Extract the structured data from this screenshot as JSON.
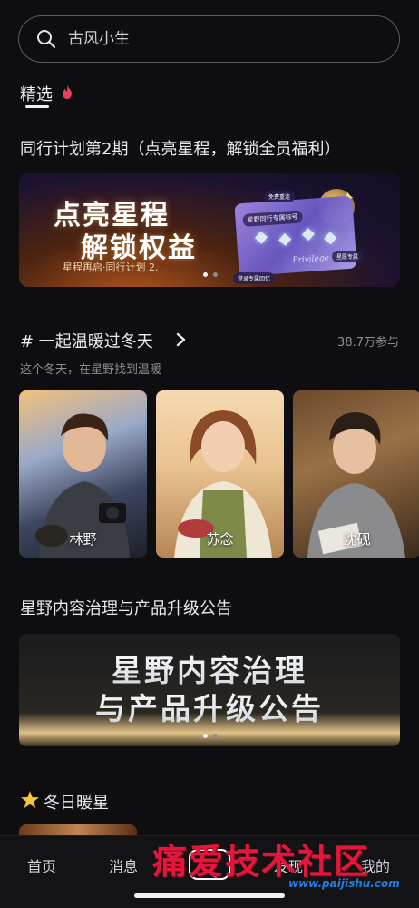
{
  "search": {
    "placeholder": "古风小生",
    "icon": "search-icon"
  },
  "tabs": [
    {
      "label": "精选",
      "active": true,
      "icon": "fire-icon"
    }
  ],
  "feature": {
    "title": "同行计划第2期（点亮星程，解锁全员福利）",
    "banner": {
      "line1": "点亮星程",
      "line2": "解锁权益",
      "sub": "星程再启·同行计划 2.",
      "card_tags": [
        "免费重连",
        "星野同行专属标号",
        "星愿专属",
        "星野书签",
        "登录专属回忆",
        "星野体内公益"
      ],
      "card_script": "Privilege Gift",
      "page": 1,
      "pages": 2
    }
  },
  "topic": {
    "title": "# 一起温暖过冬天",
    "count": "38.7万参与",
    "desc": "这个冬天，在星野找到温暖",
    "cards": [
      {
        "name": "林野"
      },
      {
        "name": "苏念"
      },
      {
        "name": "沈砚"
      }
    ]
  },
  "notice": {
    "title": "星野内容治理与产品升级公告",
    "banner_l1": "星野内容治理",
    "banner_l2": "与产品升级公告",
    "page": 1,
    "pages": 2
  },
  "winter": {
    "title": "冬日暖星",
    "icon": "star-icon"
  },
  "nav": {
    "items": [
      "首页",
      "消息",
      "发现",
      "我的"
    ]
  },
  "watermark": {
    "text": "痛爱技术社区",
    "url": "www.paijishu.com"
  },
  "colors": {
    "background": "#0e0e10",
    "accent": "#e84b7a",
    "watermark": "#e3173b"
  }
}
